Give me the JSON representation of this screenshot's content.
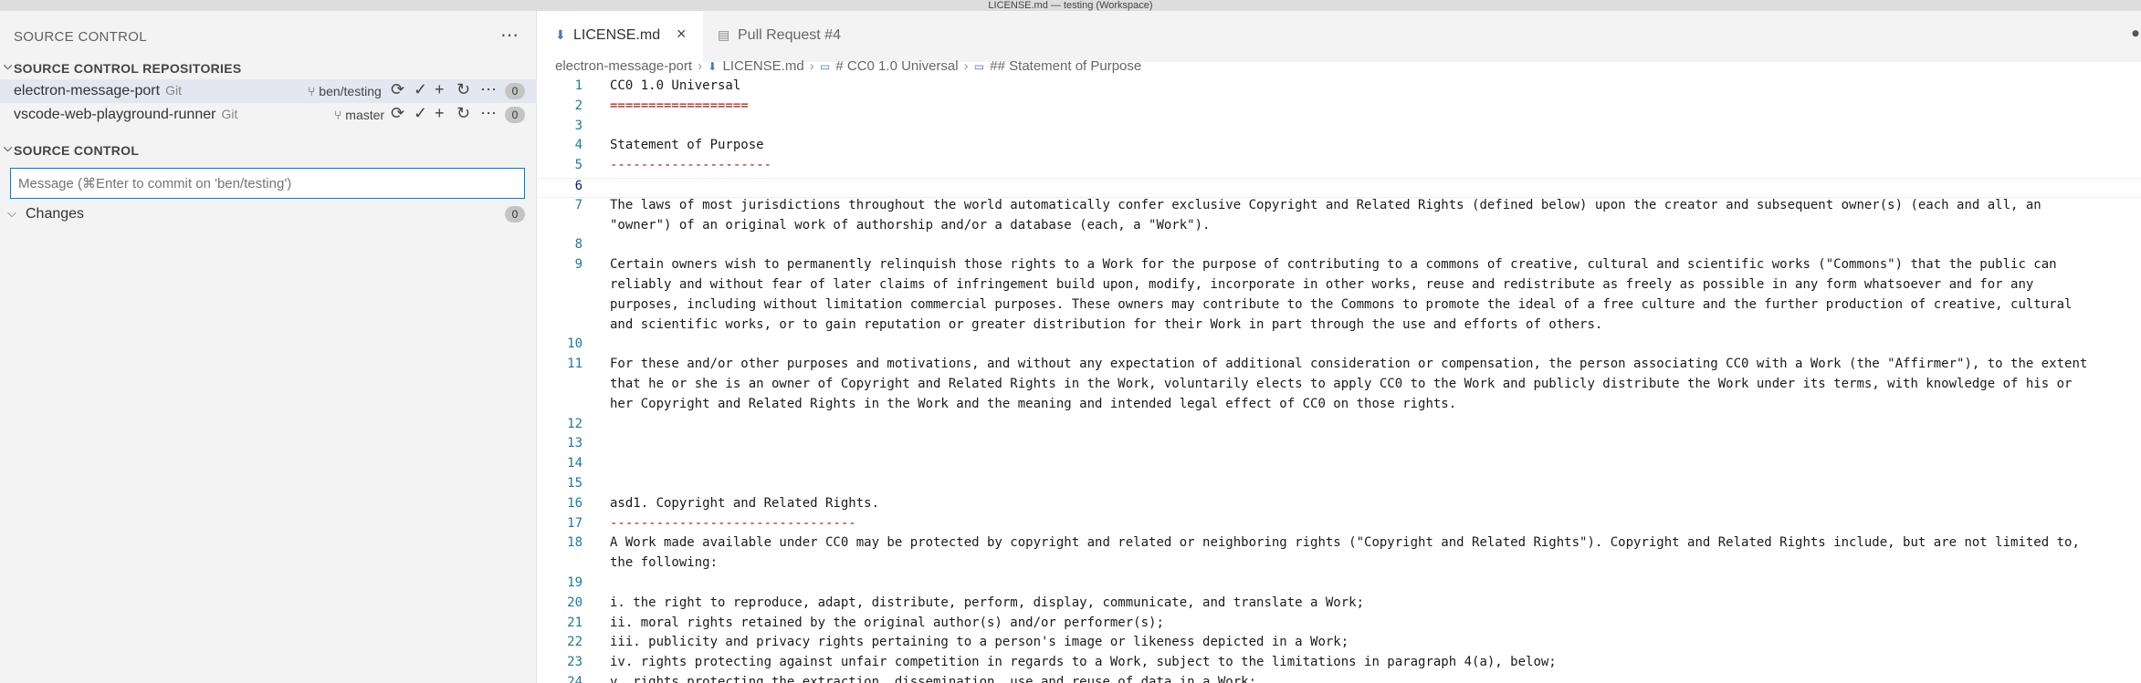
{
  "window": {
    "title": "LICENSE.md — testing (Workspace)"
  },
  "sidebar": {
    "header": "SOURCE CONTROL",
    "repositories_section": "SOURCE CONTROL REPOSITORIES",
    "repositories": [
      {
        "name": "electron-message-port",
        "scm": "Git",
        "branch": "ben/testing",
        "count": "0"
      },
      {
        "name": "vscode-web-playground-runner",
        "scm": "Git",
        "branch": "master",
        "count": "0"
      }
    ],
    "source_control_section": "SOURCE CONTROL",
    "commit_placeholder": "Message (⌘Enter to commit on 'ben/testing')",
    "changes_label": "Changes",
    "changes_count": "0"
  },
  "tabs": [
    {
      "label": "LICENSE.md",
      "active": true
    },
    {
      "label": "Pull Request #4",
      "active": false
    }
  ],
  "breadcrumbs": [
    "electron-message-port",
    "LICENSE.md",
    "# CC0 1.0 Universal",
    "## Statement of Purpose"
  ],
  "editor": {
    "current_line": 6,
    "lines": [
      {
        "n": "1",
        "text": "CC0 1.0 Universal"
      },
      {
        "n": "2",
        "text": "=================="
      },
      {
        "n": "3",
        "text": ""
      },
      {
        "n": "4",
        "text": "Statement of Purpose"
      },
      {
        "n": "5",
        "text": "---------------------"
      },
      {
        "n": "6",
        "text": ""
      },
      {
        "n": "7",
        "text": "The laws of most jurisdictions throughout the world automatically confer exclusive Copyright and Related Rights (defined below) upon the creator and subsequent owner(s) (each and all, an"
      },
      {
        "n": "",
        "text": "\"owner\") of an original work of authorship and/or a database (each, a \"Work\")."
      },
      {
        "n": "8",
        "text": ""
      },
      {
        "n": "9",
        "text": "Certain owners wish to permanently relinquish those rights to a Work for the purpose of contributing to a commons of creative, cultural and scientific works (\"Commons\") that the public can"
      },
      {
        "n": "",
        "text": "reliably and without fear of later claims of infringement build upon, modify, incorporate in other works, reuse and redistribute as freely as possible in any form whatsoever and for any"
      },
      {
        "n": "",
        "text": "purposes, including without limitation commercial purposes. These owners may contribute to the Commons to promote the ideal of a free culture and the further production of creative, cultural"
      },
      {
        "n": "",
        "text": "and scientific works, or to gain reputation or greater distribution for their Work in part through the use and efforts of others."
      },
      {
        "n": "10",
        "text": ""
      },
      {
        "n": "11",
        "text": "For these and/or other purposes and motivations, and without any expectation of additional consideration or compensation, the person associating CC0 with a Work (the \"Affirmer\"), to the extent"
      },
      {
        "n": "",
        "text": "that he or she is an owner of Copyright and Related Rights in the Work, voluntarily elects to apply CC0 to the Work and publicly distribute the Work under its terms, with knowledge of his or"
      },
      {
        "n": "",
        "text": "her Copyright and Related Rights in the Work and the meaning and intended legal effect of CC0 on those rights."
      },
      {
        "n": "12",
        "text": ""
      },
      {
        "n": "13",
        "text": ""
      },
      {
        "n": "14",
        "text": ""
      },
      {
        "n": "15",
        "text": ""
      },
      {
        "n": "16",
        "text": "asd1. Copyright and Related Rights."
      },
      {
        "n": "17",
        "text": "--------------------------------"
      },
      {
        "n": "18",
        "text": "A Work made available under CC0 may be protected by copyright and related or neighboring rights (\"Copyright and Related Rights\"). Copyright and Related Rights include, but are not limited to,"
      },
      {
        "n": "",
        "text": "the following:"
      },
      {
        "n": "19",
        "text": ""
      },
      {
        "n": "20",
        "text": "i. the right to reproduce, adapt, distribute, perform, display, communicate, and translate a Work;"
      },
      {
        "n": "21",
        "text": "ii. moral rights retained by the original author(s) and/or performer(s);"
      },
      {
        "n": "22",
        "text": "iii. publicity and privacy rights pertaining to a person's image or likeness depicted in a Work;"
      },
      {
        "n": "23",
        "text": "iv. rights protecting against unfair competition in regards to a Work, subject to the limitations in paragraph 4(a), below;"
      },
      {
        "n": "24",
        "text": "v. rights protecting the extraction, dissemination, use and reuse of data in a Work;"
      }
    ]
  },
  "colors": {
    "accent": "#0078d4",
    "heading_rule": "#a31515",
    "line_number": "#237893"
  }
}
